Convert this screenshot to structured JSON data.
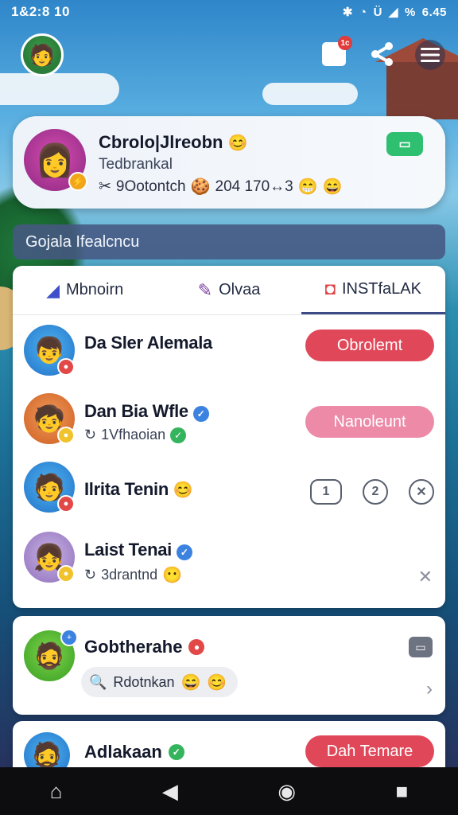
{
  "status": {
    "time": "1&2:8 10",
    "battery": "6.45"
  },
  "header": {
    "notif_badge": "1c",
    "share_icon": "share-icon",
    "menu_icon": "hamburger-icon"
  },
  "profile": {
    "name": "Cbrolo|Jlreobn",
    "subtitle": "Tedbrankal",
    "stats_left": "9Ootontch",
    "stats_right": "204 170↔3"
  },
  "banner": {
    "text": "Gojala Ifealcncu"
  },
  "tabs": [
    {
      "label": "Mbnoirn",
      "icon": "chat-icon"
    },
    {
      "label": "Olvaa",
      "icon": "pen-icon"
    },
    {
      "label": "INSTfaLAK",
      "icon": "message-icon"
    }
  ],
  "rows": [
    {
      "name": "Da Sler Alemala",
      "action": "Obrolemt"
    },
    {
      "name": "Dan Bia Wfle",
      "sub": "1Vfhaoian",
      "action": "Nanoleunt"
    },
    {
      "name": "Ilrita Tenin",
      "controls": [
        "1",
        "2"
      ]
    },
    {
      "name": "Laist Tenai",
      "sub": "3drantnd"
    }
  ],
  "card2": {
    "name": "Gobtherahe",
    "chip": "Rdotnkan"
  },
  "card3": {
    "name": "Adlakaan",
    "action": "Dah Temare"
  },
  "colors": {
    "accent": "#3c4a86",
    "pill_red": "#e0485a",
    "pill_pink": "#ec8aa8",
    "green": "#2fbf71"
  }
}
